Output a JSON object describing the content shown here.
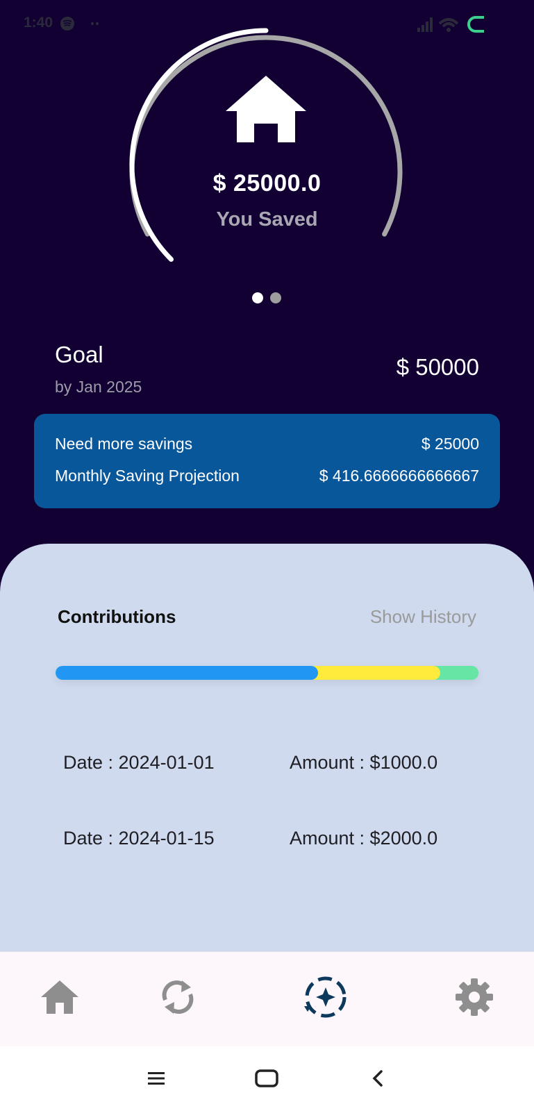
{
  "status_bar": {
    "time": "1:40"
  },
  "hero": {
    "saved_amount": "$ 25000.0",
    "saved_label": "You Saved",
    "progress_fraction": 0.5,
    "icon": "house-icon",
    "pager": {
      "pages": 2,
      "active": 0
    }
  },
  "goal": {
    "title": "Goal",
    "date": "by Jan 2025",
    "amount": "$ 50000"
  },
  "info_card": {
    "need_more_label": "Need more savings",
    "need_more_value": "$ 25000",
    "monthly_label": "Monthly Saving Projection",
    "monthly_value": "$ 416.6666666666667"
  },
  "contributions": {
    "title": "Contributions",
    "show_history": "Show History",
    "bar_segments": [
      {
        "color": "#2196f3",
        "fraction": 0.62
      },
      {
        "color": "#ffeb3b",
        "fraction": 0.29
      },
      {
        "color": "#65e6a5",
        "fraction": 0.09
      }
    ],
    "rows": [
      {
        "date": "Date : 2024-01-01",
        "amount": "Amount : $1000.0"
      },
      {
        "date": "Date : 2024-01-15",
        "amount": "Amount : $2000.0"
      }
    ]
  },
  "bottom_nav": {
    "items": [
      {
        "icon": "home-icon",
        "active": false
      },
      {
        "icon": "sync-icon",
        "active": false
      },
      {
        "icon": "goal-icon",
        "active": true
      },
      {
        "icon": "settings-icon",
        "active": false
      }
    ]
  },
  "colors": {
    "background": "#130033",
    "card": "#08579b",
    "sheet": "#cfdaee",
    "nav_active": "#0d3a5c",
    "nav_inactive": "#8e8e8e"
  }
}
